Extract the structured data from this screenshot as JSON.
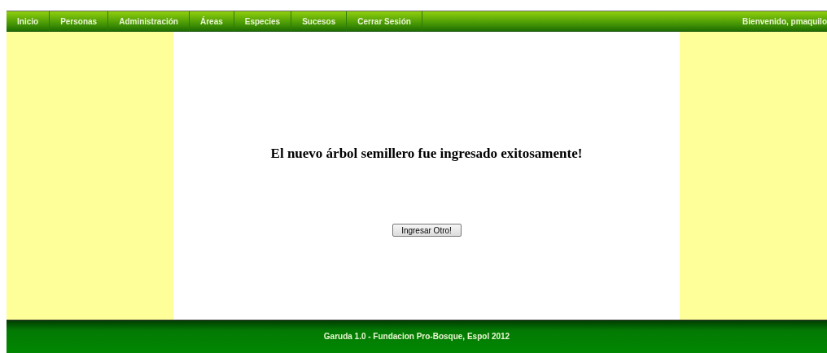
{
  "nav": {
    "items": [
      {
        "label": "Inicio"
      },
      {
        "label": "Personas"
      },
      {
        "label": "Administración"
      },
      {
        "label": "Áreas"
      },
      {
        "label": "Especies"
      },
      {
        "label": "Sucesos"
      },
      {
        "label": "Cerrar Sesión"
      }
    ],
    "welcome": "Bienvenido, pmaquilo"
  },
  "message": "El nuevo árbol semillero fue ingresado exitosamente!",
  "button": "Ingresar Otro!",
  "footer": {
    "lines": [
      "Garuda 1.0 - Fundacion Pro-Bosque, Espol 2012"
    ]
  }
}
